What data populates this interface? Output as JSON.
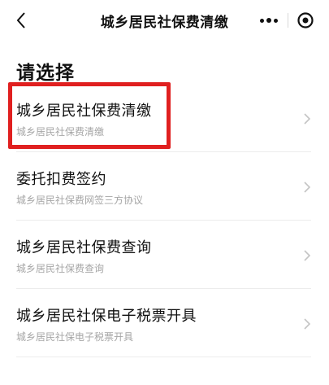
{
  "nav": {
    "title": "城乡居民社保费清缴",
    "back_icon": "chevron-left-icon",
    "more_icon": "more-dots-icon",
    "close_icon": "target-circle-icon"
  },
  "heading": "请选择",
  "items": [
    {
      "title": "城乡居民社保费清缴",
      "subtitle": "城乡居民社保费清缴"
    },
    {
      "title": "委托扣费签约",
      "subtitle": "城乡居民社保费网签三方协议"
    },
    {
      "title": "城乡居民社保费查询",
      "subtitle": "城乡居民社保费查询"
    },
    {
      "title": "城乡居民社保电子税票开具",
      "subtitle": "城乡居民社保电子税票开具"
    }
  ],
  "colors": {
    "highlight": "#e02020",
    "subtitle": "#a6a6a6",
    "divider": "#ececec"
  }
}
